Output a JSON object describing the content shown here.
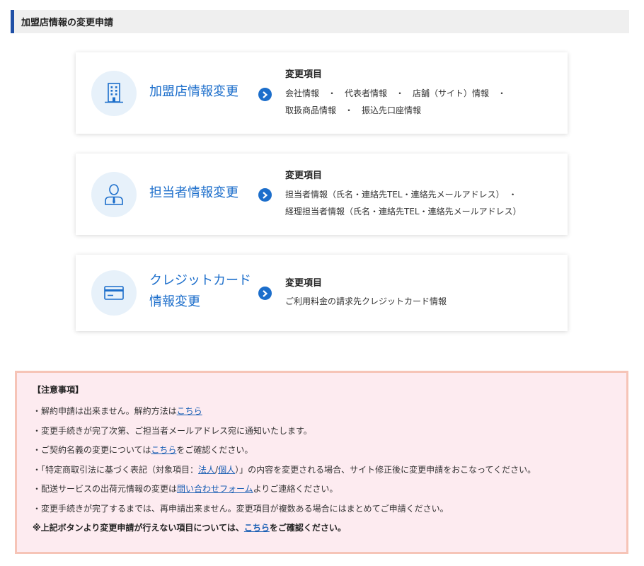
{
  "header": {
    "title": "加盟店情報の変更申請"
  },
  "cards": [
    {
      "title": "加盟店情報変更",
      "icon": "building-icon",
      "items_title": "変更項目",
      "items_line1": "会社情報　・　代表者情報　・　店舗（サイト）情報　・",
      "items_line2": "取扱商品情報　・　振込先口座情報"
    },
    {
      "title": "担当者情報変更",
      "icon": "person-icon",
      "items_title": "変更項目",
      "items_line1": "担当者情報（氏名・連絡先TEL・連絡先メールアドレス）　・",
      "items_line2": "経理担当者情報（氏名・連絡先TEL・連絡先メールアドレス）"
    },
    {
      "title_line1": "クレジットカード",
      "title_line2": "情報変更",
      "icon": "credit-card-icon",
      "items_title": "変更項目",
      "items_line1": "ご利用料金の請求先クレジットカード情報"
    }
  ],
  "notice": {
    "title": "【注意事項】",
    "l1_pre": "・解約申請は出来ません。解約方法は",
    "l1_link": "こちら",
    "l2": "・変更手続きが完了次第、ご担当者メールアドレス宛に通知いたします。",
    "l3_pre": "・ご契約名義の変更については",
    "l3_link": "こちら",
    "l3_post": "をご確認ください。",
    "l4_pre": "・「特定商取引法に基づく表記（対象項目：",
    "l4_link1": "法人",
    "l4_sep": "/",
    "l4_link2": "個人",
    "l4_post": "）」の内容を変更される場合、サイト修正後に変更申請をおこなってください。",
    "l5_pre": "・配送サービスの出荷元情報の変更は",
    "l5_link": "問い合わせフォーム",
    "l5_post": "よりご連絡ください。",
    "l6": "・変更手続きが完了するまでは、再申請出来ません。変更項目が複数ある場合にはまとめてご申請ください。",
    "bold_pre": "※上記ボタンより変更申請が行えない項目については、",
    "bold_link": "こちら",
    "bold_post": "をご確認ください。"
  },
  "colors": {
    "accent": "#1c6ecb",
    "header_border": "#1f4fa6",
    "notice_bg": "#fdebf0",
    "notice_border": "#f6c4b7",
    "icon_bg": "#e7f1fa"
  }
}
